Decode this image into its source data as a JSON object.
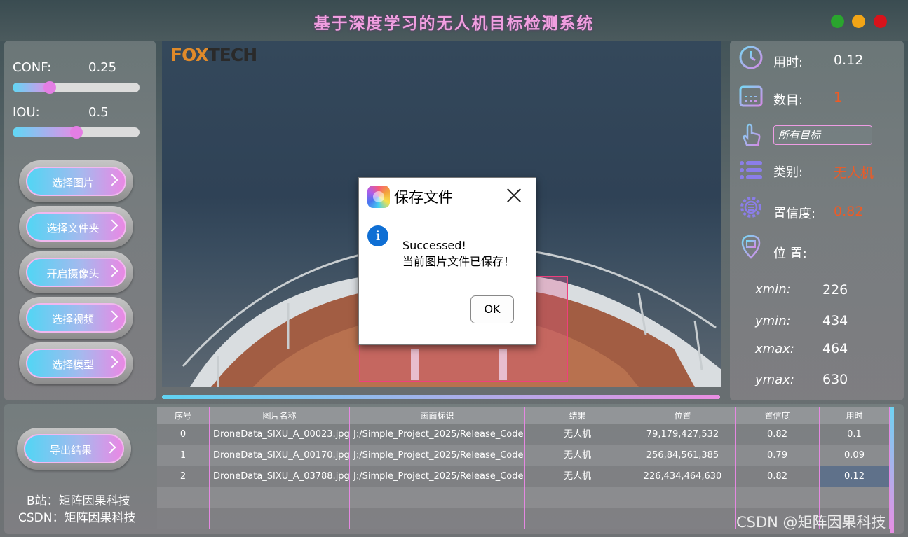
{
  "window": {
    "title": "基于深度学习的无人机目标检测系统"
  },
  "controls": {
    "conf": {
      "label": "CONF:",
      "value": "0.25",
      "fraction": 0.25
    },
    "iou": {
      "label": "IOU:",
      "value": "0.5",
      "fraction": 0.5
    }
  },
  "buttons": {
    "select_image": "选择图片",
    "select_folder": "选择文件夹",
    "open_camera": "开启摄像头",
    "select_video": "选择视频",
    "select_model": "选择模型",
    "export_results": "导出结果"
  },
  "credits": {
    "bilibili": "B站：矩阵因果科技",
    "csdn": "CSDN：矩阵因果科技"
  },
  "video": {
    "logo_prefix": "FOX",
    "logo_suffix": "TECH",
    "progress": 1.0
  },
  "dialog": {
    "title": "保存文件",
    "message_line1": "Successed!",
    "message_line2": "当前图片文件已保存！",
    "ok_label": "OK"
  },
  "stats": {
    "time_label": "用时:",
    "time_value": "0.12",
    "count_label": "数目:",
    "count_value": "1",
    "target_select": "所有目标",
    "class_label": "类别:",
    "class_value": "无人机",
    "confidence_label": "置信度:",
    "confidence_value": "0.82",
    "position_label": "位 置:",
    "xmin_label": "xmin:",
    "xmin_value": "226",
    "ymin_label": "ymin:",
    "ymin_value": "434",
    "xmax_label": "xmax:",
    "xmax_value": "464",
    "ymax_label": "ymax:",
    "ymax_value": "630"
  },
  "table": {
    "headers": [
      "序号",
      "图片名称",
      "画面标识",
      "结果",
      "位置",
      "置信度",
      "用时"
    ],
    "rows": [
      [
        "0",
        "DroneData_SIXU_A_00023.jpg",
        "J:/Simple_Project_2025/Release_Code...",
        "无人机",
        "79,179,427,532",
        "0.82",
        "0.1"
      ],
      [
        "1",
        "DroneData_SIXU_A_00170.jpg",
        "J:/Simple_Project_2025/Release_Code...",
        "无人机",
        "256,84,561,385",
        "0.79",
        "0.09"
      ],
      [
        "2",
        "DroneData_SIXU_A_03788.jpg",
        "J:/Simple_Project_2025/Release_Code...",
        "无人机",
        "226,434,464,630",
        "0.82",
        "0.12"
      ],
      [
        "",
        "",
        "",
        "",
        "",
        "",
        ""
      ],
      [
        "",
        "",
        "",
        "",
        "",
        "",
        ""
      ]
    ]
  },
  "watermark": "CSDN @矩阵因果科技",
  "colors": {
    "accent_pink": "#f09fe0",
    "accent_cyan": "#52d5f4",
    "result_orange": "#f05a24"
  }
}
